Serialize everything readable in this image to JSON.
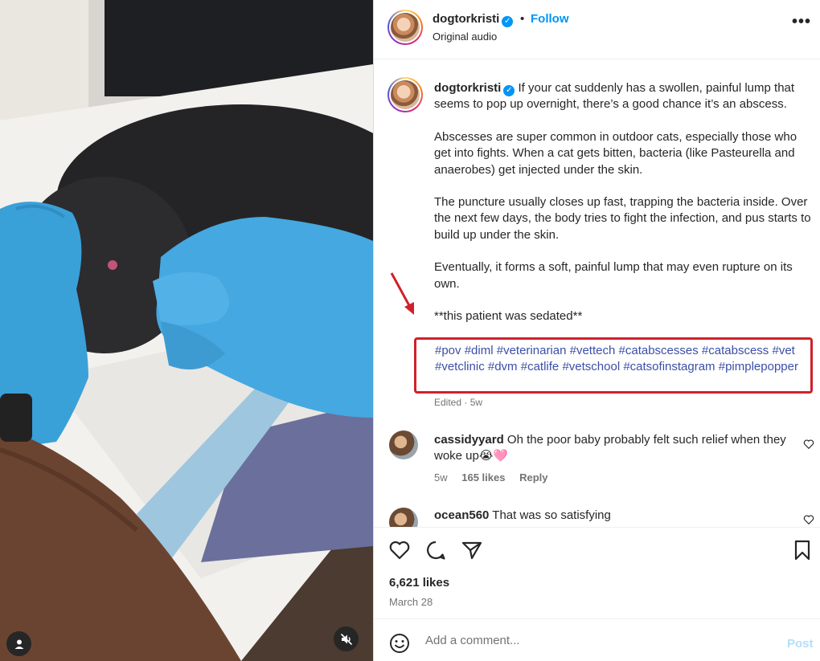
{
  "post": {
    "username": "dogtorkristi",
    "verified_icon": "verified-badge-icon",
    "separator": "•",
    "follow_label": "Follow",
    "audio_label": "Original audio",
    "more_icon": "more-options-icon",
    "more_label": "•••"
  },
  "caption": {
    "username": "dogtorkristi",
    "paragraphs": [
      "If your cat suddenly has a swollen, painful lump that seems to pop up overnight, there’s a good chance it’s an abscess.",
      "Abscesses are super common in outdoor cats, especially those who get into fights. When a cat gets bitten, bacteria (like Pasteurella and anaerobes) get injected under the skin.",
      "The puncture usually closes up fast, trapping the bacteria inside. Over the next few days, the body tries to fight the infection, and pus starts to build up under the skin.",
      "Eventually, it forms a soft, painful lump that may even rupture on its own.",
      "**this patient was sedated**"
    ],
    "hashtags": [
      "#pov",
      "#diml",
      "#veterinarian",
      "#vettech",
      "#catabscesses",
      "#catabscess",
      "#vet",
      "#vetclinic",
      "#dvm",
      "#catlife",
      "#vetschool",
      "#catsofinstagram",
      "#pimplepopper"
    ],
    "edited": "Edited · 5w",
    "highlight_color": "#d0202a"
  },
  "comments": [
    {
      "username": "cassidyyard",
      "text": "Oh the poor baby probably felt such relief when they woke up😭🩷",
      "age": "5w",
      "likes": "165 likes",
      "reply": "Reply"
    },
    {
      "username": "ocean560",
      "text": "That was so satisfying"
    }
  ],
  "actions": {
    "likes": "6,621 likes",
    "date": "March 28"
  },
  "add_comment": {
    "placeholder": "Add a comment...",
    "post_label": "Post"
  },
  "colors": {
    "accent": "#0095f6",
    "hashtag": "#3a4fa8"
  }
}
